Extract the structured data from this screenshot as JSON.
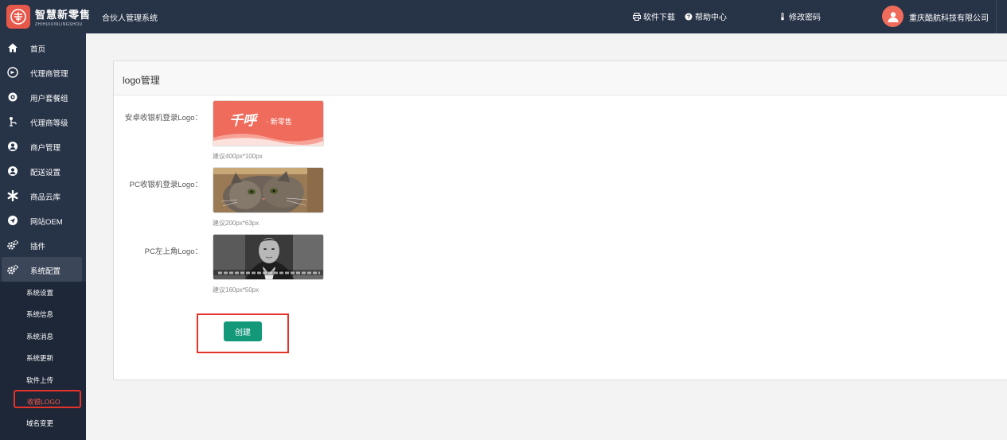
{
  "header": {
    "brand_name": "智慧新零售",
    "brand_sub": "ZHIHUIXINLINGSHOU",
    "system_title": "合伙人管理系统",
    "links": {
      "download": "软件下载",
      "help": "帮助中心",
      "password": "修改密码"
    },
    "company": "重庆酷航科技有限公司"
  },
  "sidebar": {
    "items": [
      {
        "label": "首页",
        "icon": "home-icon"
      },
      {
        "label": "代理商管理",
        "icon": "agent-icon"
      },
      {
        "label": "用户套餐组",
        "icon": "package-icon"
      },
      {
        "label": "代理商等级",
        "icon": "level-icon"
      },
      {
        "label": "商户管理",
        "icon": "merchant-icon"
      },
      {
        "label": "配送设置",
        "icon": "delivery-icon"
      },
      {
        "label": "商品云库",
        "icon": "cloud-icon"
      },
      {
        "label": "网站OEM",
        "icon": "send-icon"
      },
      {
        "label": "插件",
        "icon": "plugin-gear-icon"
      },
      {
        "label": "系统配置",
        "icon": "settings-gear-icon"
      }
    ],
    "sub_items": [
      "系统设置",
      "系统信息",
      "系统消息",
      "系统更新",
      "软件上传",
      "收银LOGO",
      "域名变更"
    ],
    "active_item": "系统配置",
    "current_sub": "收银LOGO"
  },
  "panel": {
    "title": "logo管理",
    "rows": [
      {
        "label": "安卓收银机登录Logo：",
        "hint": "建议400px*100px",
        "image": "qianhu-logo",
        "logo_text": "千呼",
        "logo_sub": "· 新零售"
      },
      {
        "label": "PC收银机登录Logo：",
        "hint": "建议200px*63px",
        "image": "cat-photo"
      },
      {
        "label": "PC左上角Logo：",
        "hint": "建议160px*50px",
        "image": "man-portrait-photo"
      }
    ],
    "create_label": "创建"
  },
  "colors": {
    "header_bg": "#273347",
    "submenu_bg": "#1d2737",
    "accent_red": "#e5332a",
    "create_green": "#14987a",
    "logo_orange": "#ef6b5b"
  }
}
